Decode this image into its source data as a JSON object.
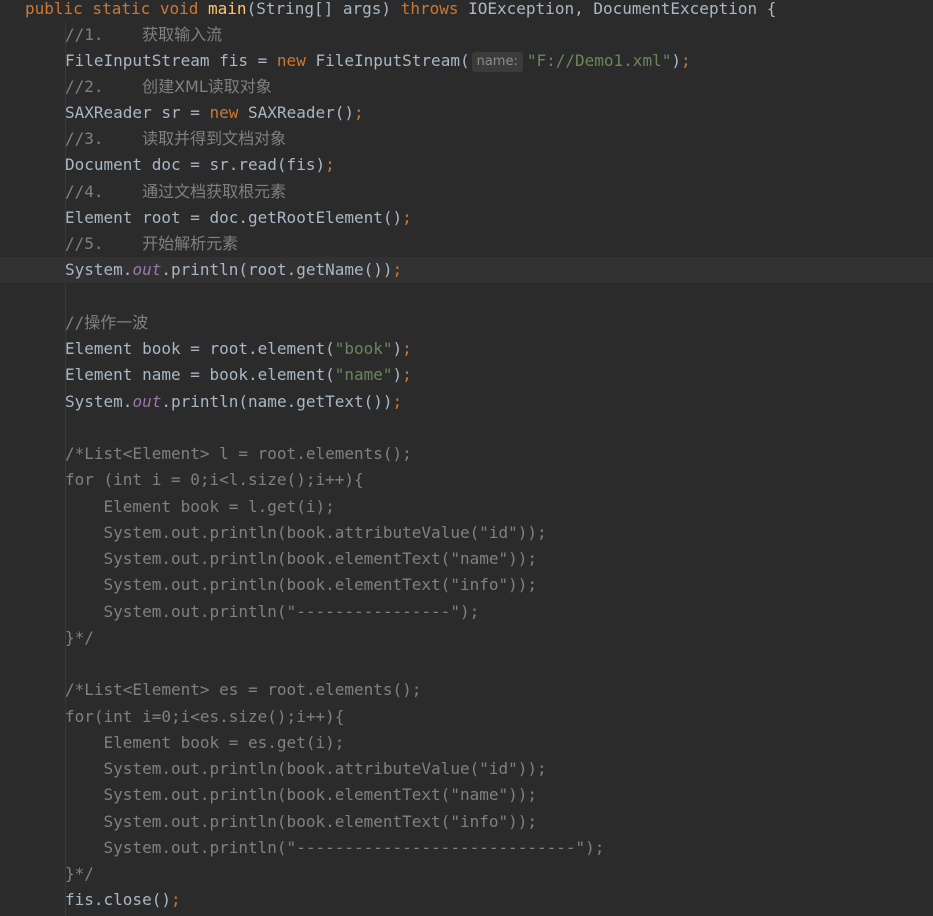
{
  "editor": {
    "signature": {
      "mods": "public static void ",
      "name": "main",
      "params": "(String[] args) ",
      "throws_kw": "throws",
      "exceptions": " IOException, DocumentException {"
    },
    "c1": {
      "num": "//1.",
      "text": "获取输入流"
    },
    "fis_line": {
      "decl": "FileInputStream fis = ",
      "new_kw": "new",
      "call": " FileInputStream(",
      "hint": "name:",
      "arg": "\"F://Demo1.xml\"",
      "close": ")",
      "semi": ";"
    },
    "c2": {
      "num": "//2.",
      "text": "创建XML读取对象"
    },
    "sax_line": {
      "decl": "SAXReader sr = ",
      "new_kw": "new",
      "call": " SAXReader()",
      "semi": ";"
    },
    "c3": {
      "num": "//3.",
      "text": "读取并得到文档对象"
    },
    "doc_line": {
      "code": "Document doc = sr.read(fis)",
      "semi": ";"
    },
    "c4": {
      "num": "//4.",
      "text": "通过文档获取根元素"
    },
    "root_line": {
      "code": "Element root = doc.getRootElement()",
      "semi": ";"
    },
    "c5": {
      "num": "//5.",
      "text": "开始解析元素"
    },
    "print_root": {
      "pre": "System.",
      "field": "out",
      "post": ".println(root.getName())",
      "semi": ";"
    },
    "c6": {
      "prefix": "//",
      "text": "操作一波"
    },
    "book_line": {
      "pre": "Element book = root.element(",
      "arg": "\"book\"",
      "close": ")",
      "semi": ";"
    },
    "name_line": {
      "pre": "Element name = book.element(",
      "arg": "\"name\"",
      "close": ")",
      "semi": ";"
    },
    "print_name": {
      "pre": "System.",
      "field": "out",
      "post": ".println(name.getText())",
      "semi": ";"
    },
    "block1": [
      "/*List<Element> l = root.elements();",
      "for (int i = 0;i<l.size();i++){",
      "    Element book = l.get(i);",
      "    System.out.println(book.attributeValue(\"id\"));",
      "    System.out.println(book.elementText(\"name\"));",
      "    System.out.println(book.elementText(\"info\"));",
      "    System.out.println(\"----------------\");",
      "}*/"
    ],
    "block2": [
      "/*List<Element> es = root.elements();",
      "for(int i=0;i<es.size();i++){",
      "    Element book = es.get(i);",
      "    System.out.println(book.attributeValue(\"id\"));",
      "    System.out.println(book.elementText(\"name\"));",
      "    System.out.println(book.elementText(\"info\"));",
      "    System.out.println(\"-----------------------------\");",
      "}*/"
    ],
    "close_line": {
      "code": "fis.close()",
      "semi": ";"
    }
  }
}
